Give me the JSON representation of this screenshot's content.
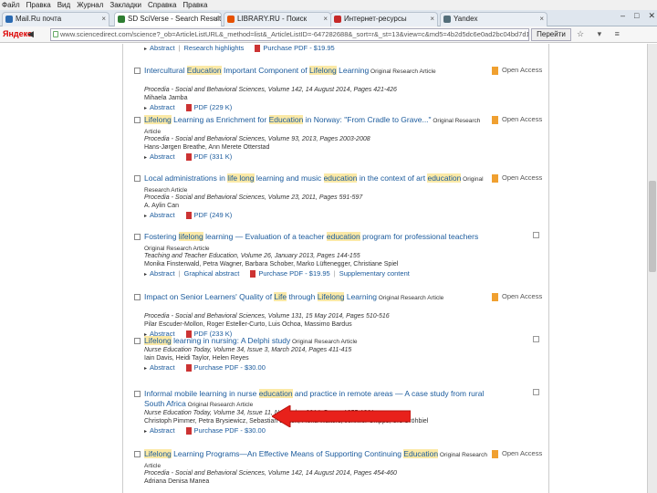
{
  "menubar": {
    "items": [
      "Файл",
      "Правка",
      "Вид",
      "Журнал",
      "Закладки",
      "Справка",
      "Правка"
    ]
  },
  "tabs": [
    {
      "label": "Mail.Ru почта",
      "color": "#2a6ab2"
    },
    {
      "label": "SD SciVerse - Search Results - ScienceDirect",
      "color": "#2e7d32"
    },
    {
      "label": "LIBRARY.RU - Поиск",
      "color": "#e65100"
    },
    {
      "label": "Интернет-ресурсы",
      "color": "#c62828"
    },
    {
      "label": "Yandex",
      "color": "#546e7a"
    }
  ],
  "window_controls": [
    "–",
    "□",
    "✕"
  ],
  "nav": {
    "brand": "Яндекс",
    "back": "◀",
    "url": "www.sciencedirect.com/science?_ob=ArticleListURL&_method=list&_ArticleListID=-647282688&_sort=r&_st=13&view=c&md5=4b2d5dc6e0ad2bc04bd7d1fd1fdcab5d&searchtype=a",
    "go_label": "Перейти",
    "icons": "☆ ▾ ≡"
  },
  "results": [
    {
      "title_parts": [
        {
          "t": "Abstract",
          "h": false
        }
      ],
      "type": "",
      "source": "",
      "authors": "",
      "links": [
        "Abstract",
        "Research highlights",
        "Purchase PDF - $19.95"
      ],
      "oa": ""
    },
    {
      "title_parts": [
        {
          "t": "Intercultural ",
          "h": false
        },
        {
          "t": "Education",
          "h": true
        },
        {
          "t": " Important Component of ",
          "h": false
        },
        {
          "t": "Lifelong",
          "h": true
        },
        {
          "t": " Learning",
          "h": false
        }
      ],
      "type": "Original Research Article",
      "source": "Procedia - Social and Behavioral Sciences, Volume 142, 14 August 2014, Pages 421-426",
      "authors": "Mihaela Jamba",
      "links": [
        "Abstract",
        "PDF (229 K)"
      ],
      "oa": "Open Access"
    },
    {
      "title_parts": [
        {
          "t": "Lifelong",
          "h": true
        },
        {
          "t": " Learning as Enrichment for ",
          "h": false
        },
        {
          "t": "Education",
          "h": true
        },
        {
          "t": " in Norway: \"From Cradle to Grave...\"",
          "h": false
        }
      ],
      "type": "Original Research Article",
      "source": "Procedia - Social and Behavioral Sciences, Volume 93, 2013, Pages 2003-2008",
      "authors": "Hans-Jørgen Breathe, Ann Merete Otterstad",
      "links": [
        "Abstract",
        "PDF (331 K)"
      ],
      "oa": "Open Access"
    },
    {
      "title_parts": [
        {
          "t": "Local administrations in ",
          "h": false
        },
        {
          "t": "life long",
          "h": true
        },
        {
          "t": " learning and music ",
          "h": false
        },
        {
          "t": "education",
          "h": true
        },
        {
          "t": " in the context of art ",
          "h": false
        },
        {
          "t": "education",
          "h": true
        }
      ],
      "type": "Original Research Article",
      "source": "Procedia - Social and Behavioral Sciences, Volume 23, 2011, Pages 591-597",
      "authors": "A. Aylin Can",
      "links": [
        "Abstract",
        "PDF (249 K)"
      ],
      "oa": "Open Access"
    },
    {
      "title_parts": [
        {
          "t": "Fostering ",
          "h": false
        },
        {
          "t": "lifelong",
          "h": true
        },
        {
          "t": " learning — Evaluation of a teacher ",
          "h": false
        },
        {
          "t": "education",
          "h": true
        },
        {
          "t": " program for professional teachers",
          "h": false
        }
      ],
      "type": "Original Research Article",
      "source": "Teaching and Teacher Education, Volume 26, January 2013, Pages 144-155",
      "authors": "Monika Finsterwald, Petra Wagner, Barbara Schober, Marko Lüftenegger, Christiane Spiel",
      "links": [
        "Abstract",
        "Graphical abstract",
        "Purchase PDF - $19.95",
        "Supplementary content"
      ],
      "oa": ""
    },
    {
      "title_parts": [
        {
          "t": "Impact on Senior Learners' Quality of ",
          "h": false
        },
        {
          "t": "Life",
          "h": true
        },
        {
          "t": " through ",
          "h": false
        },
        {
          "t": "Lifelong",
          "h": true
        },
        {
          "t": " Learning",
          "h": false
        }
      ],
      "type": "Original Research Article",
      "source": "Procedia - Social and Behavioral Sciences, Volume 131, 15 May 2014, Pages 510-516",
      "authors": "Pilar Escuder-Mollon, Roger Esteller-Curto, Luis Ochoa, Massimo Bardus",
      "links": [
        "Abstract",
        "PDF (233 K)"
      ],
      "oa": "Open Access"
    },
    {
      "title_parts": [
        {
          "t": "Lifelong",
          "h": true
        },
        {
          "t": " learning in nursing: A Delphi study",
          "h": false
        }
      ],
      "type": "Original Research Article",
      "source": "Nurse Education Today, Volume 34, Issue 3, March 2014, Pages 411-415",
      "authors": "Iain Davis, Heidi Taylor, Helen Reyes",
      "links": [
        "Abstract",
        "Purchase PDF - $30.00"
      ],
      "oa": ""
    },
    {
      "title_parts": [
        {
          "t": "Informal mobile learning in nurse ",
          "h": false
        },
        {
          "t": "education",
          "h": true
        },
        {
          "t": " and practice in remote areas — A case study from rural South Africa",
          "h": false
        }
      ],
      "type": "Original Research Article",
      "source": "Nurse Education Today, Volume 34, Issue 11, November 2014, Pages 1355-1361",
      "authors": "Christoph Pimmer, Petra Brysiewicz, Sebastian Linxen, Fiona Walters, Jennifer Chipps, Urs Gröhbiel",
      "links": [
        "Abstract",
        "Purchase PDF - $30.00"
      ],
      "oa": ""
    },
    {
      "title_parts": [
        {
          "t": "Lifelong",
          "h": true
        },
        {
          "t": " Learning Programs—An Effective Means of Supporting Continuing ",
          "h": false
        },
        {
          "t": "Education",
          "h": true
        }
      ],
      "type": "Original Research Article",
      "source": "Procedia - Social and Behavioral Sciences, Volume 142, 14 August 2014, Pages 454-460",
      "authors": "Adriana Denisa Manea",
      "links": [],
      "oa": "Open Access"
    }
  ],
  "colors": {
    "arrow": "#e8211b",
    "link": "#1a5a9c",
    "highlight": "#fbe9a6"
  }
}
